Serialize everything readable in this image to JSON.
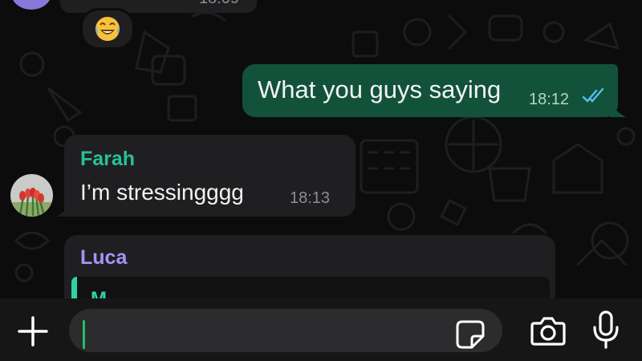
{
  "previous_message": {
    "time": "18:09"
  },
  "reaction": {
    "emoji": "😂",
    "icon": "laughing-emoji-icon"
  },
  "messages": [
    {
      "direction": "outgoing",
      "text": "What you guys saying",
      "time": "18:12",
      "status": "read",
      "status_icon": "double-check-icon"
    },
    {
      "direction": "incoming",
      "sender": "Farah",
      "text": "I’m stressingggg",
      "time": "18:13"
    },
    {
      "direction": "incoming",
      "sender": "Luca",
      "quote_preview": "M"
    }
  ],
  "input_bar": {
    "value": "",
    "icons": [
      "plus-icon",
      "sticker-icon",
      "camera-icon",
      "mic-icon"
    ]
  },
  "colors": {
    "outgoing_bubble": "#12523b",
    "incoming_bubble": "#1f1f21",
    "farah_name": "#27c197",
    "luca_name": "#a594f5",
    "read_ticks": "#53bdeb",
    "caret": "#21c063"
  }
}
